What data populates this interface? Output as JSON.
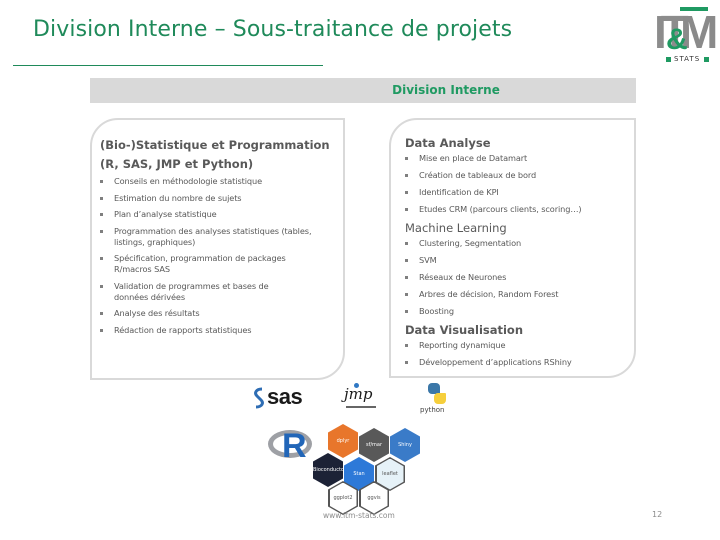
{
  "slide": {
    "title": "Division Interne – Sous-traitance de projets",
    "logo": {
      "letters": "IT",
      "amp": "&",
      "m": "M",
      "subtitle": "STATS",
      "brand_color": "#1f9a62"
    },
    "banner": "Division Interne",
    "accent_color": "#1f8a5a"
  },
  "left_panel": {
    "heading_line1": "(Bio-)Statistique et Programmation",
    "heading_line2": "(R, SAS, JMP et Python)",
    "items": [
      "Conseils en méthodologie statistique",
      "Estimation du nombre de sujets",
      "Plan d’analyse statistique",
      "Programmation des analyses statistiques (tables, listings, graphiques)",
      "Spécification, programmation de packages R/macros SAS",
      "Validation de programmes et bases de données dérivées",
      "Analyse des résultats",
      "Rédaction de rapports statistiques"
    ]
  },
  "right_panel": {
    "sections": [
      {
        "heading": "Data Analyse",
        "items": [
          "Mise en place de Datamart",
          "Création de tableaux de bord",
          "Identification de KPI",
          "Etudes CRM (parcours clients, scoring…)"
        ]
      },
      {
        "heading": "Machine Learning",
        "items": [
          "Clustering, Segmentation",
          "SVM",
          "Réseaux de Neurones",
          "Arbres de décision, Random Forest",
          "Boosting"
        ]
      },
      {
        "heading": "Data Visualisation",
        "items": [
          "Reporting dynamique",
          "Développement d’applications RShiny"
        ]
      }
    ]
  },
  "tools": {
    "sas": "sas",
    "jmp": "jmp",
    "python": "python",
    "r": "R",
    "hex_packages": [
      "dplyr",
      "sf/mar",
      "Shiny",
      "Bioconductor",
      "Stan",
      "leaflet",
      "ggplot2",
      "ggvis"
    ]
  },
  "footer": {
    "url": "www.itm-stats.com",
    "page_number": "12"
  }
}
